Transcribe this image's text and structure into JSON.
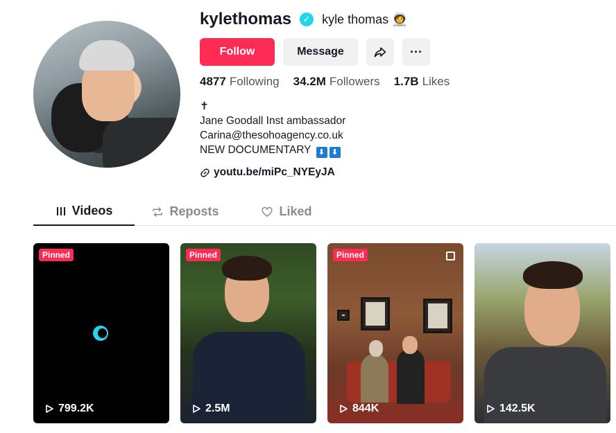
{
  "profile": {
    "username": "kylethomas",
    "nickname": "kyle thomas 🧑‍🚀",
    "verified_icon": "verified-badge-icon",
    "accent_color": "#fe2c55",
    "verified_color": "#20d5ec"
  },
  "actions": {
    "follow_label": "Follow",
    "message_label": "Message",
    "share_icon": "share-icon",
    "more_label": "···"
  },
  "stats": {
    "following_count": "4877",
    "following_label": "Following",
    "followers_count": "34.2M",
    "followers_label": "Followers",
    "likes_count": "1.7B",
    "likes_label": "Likes"
  },
  "bio": {
    "line1": "✝",
    "line2": "Jane Goodall Inst ambassador",
    "line3": "Carina@thesohoagency.co.uk",
    "line4": "NEW DOCUMENTARY",
    "arrow1": "⬇",
    "arrow2": "⬇"
  },
  "link": {
    "text": "youtu.be/miPc_NYEyJA",
    "icon": "link-icon"
  },
  "tabs": [
    {
      "label": "Videos",
      "icon": "grid-bars-icon",
      "active": true
    },
    {
      "label": "Reposts",
      "icon": "repost-icon",
      "active": false
    },
    {
      "label": "Liked",
      "icon": "heart-outline-icon",
      "active": false
    }
  ],
  "videos": [
    {
      "pinned_label": "Pinned",
      "views": "799.2K"
    },
    {
      "pinned_label": "Pinned",
      "views": "2.5M"
    },
    {
      "pinned_label": "Pinned",
      "views": "844K"
    },
    {
      "views": "142.5K"
    }
  ]
}
